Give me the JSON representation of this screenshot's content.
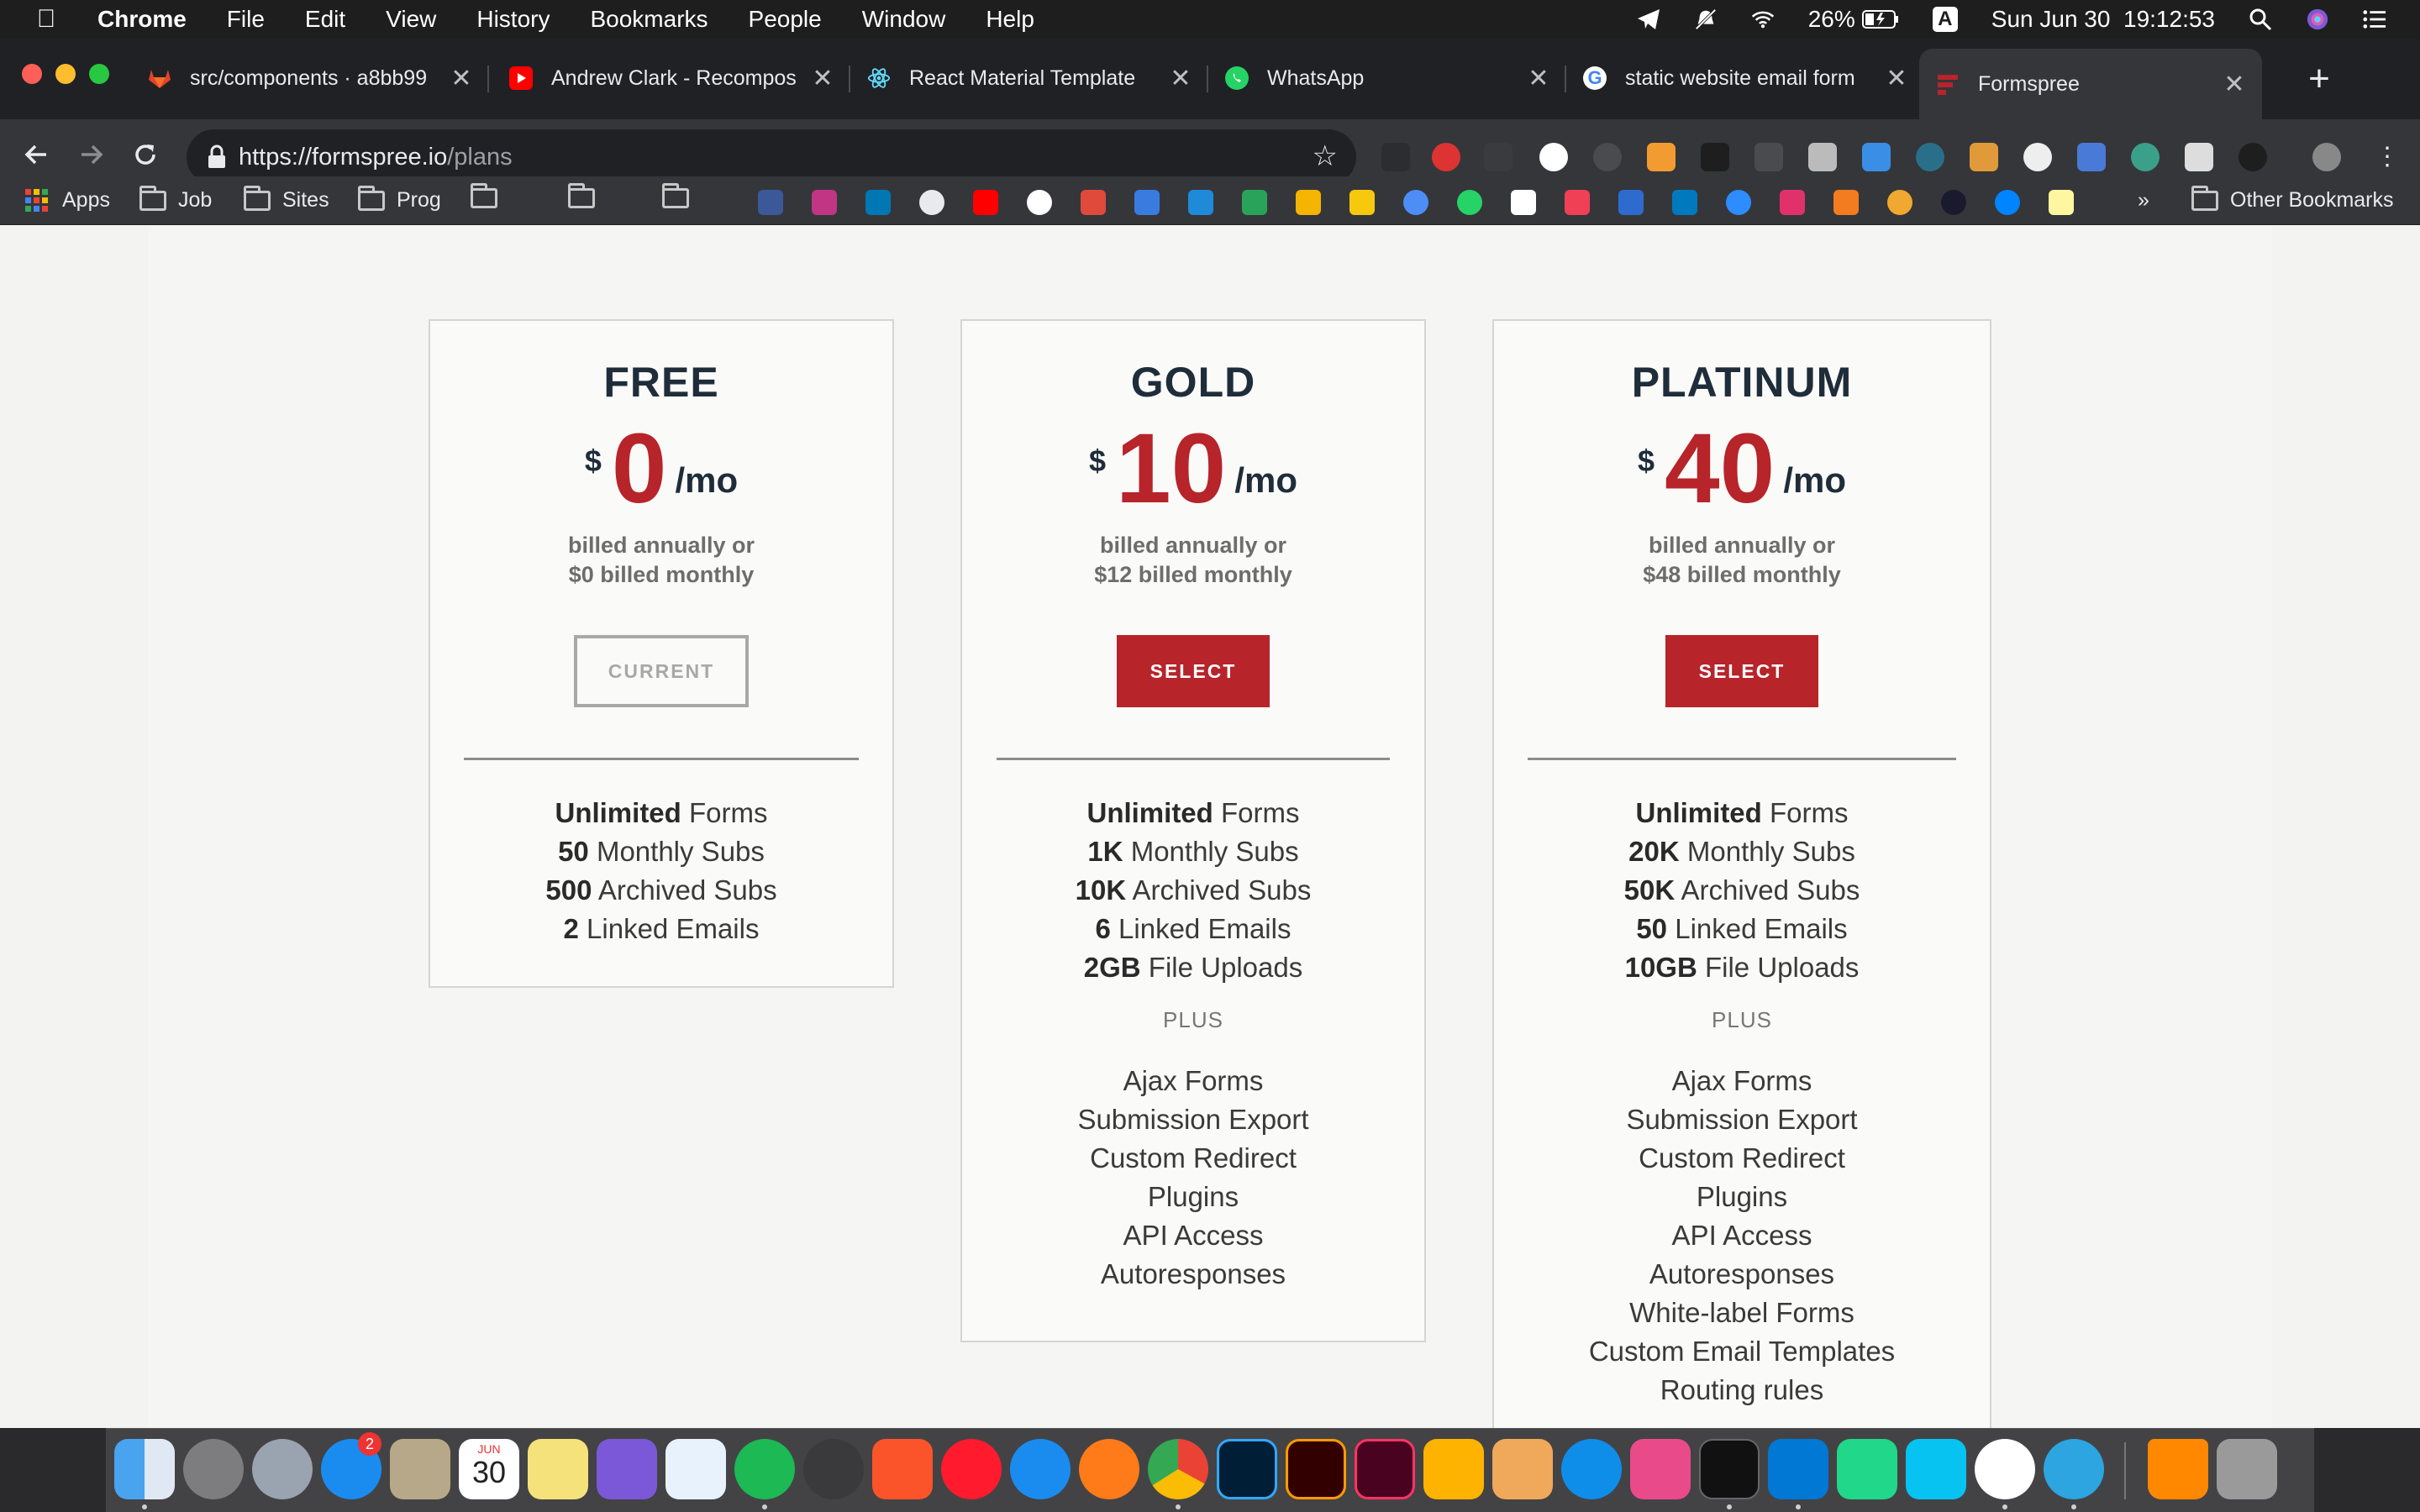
{
  "menubar": {
    "app_name": "Chrome",
    "menus": [
      "File",
      "Edit",
      "View",
      "History",
      "Bookmarks",
      "People",
      "Window",
      "Help"
    ],
    "battery": "26%",
    "input_source": "A",
    "datetime": "Sun Jun 30  19:12:53"
  },
  "tabs": [
    {
      "label": "src/components · a8bb99",
      "icon": "gitlab-icon",
      "color": "#e2432a"
    },
    {
      "label": "Andrew Clark - Recompos",
      "icon": "youtube-icon",
      "color": "#ff0000"
    },
    {
      "label": "React Material Template",
      "icon": "react-icon",
      "color": "#61dafb"
    },
    {
      "label": "WhatsApp",
      "icon": "whatsapp-icon",
      "color": "#25d366"
    },
    {
      "label": "static website email form",
      "icon": "google-icon",
      "color": "#4285f4"
    },
    {
      "label": "Formspree",
      "icon": "formspree-icon",
      "color": "#b7242a"
    }
  ],
  "address": {
    "scheme_host": "https://formspree.io",
    "path": "/plans"
  },
  "bookmarks": {
    "apps": "Apps",
    "folders": [
      "Job",
      "Sites",
      "Prog"
    ],
    "more": "»",
    "other": "Other Bookmarks"
  },
  "plans": [
    {
      "name": "FREE",
      "currency": "$",
      "amount": "0",
      "period": "/mo",
      "billing_line1": "billed annually or",
      "billing_line2": "$0 billed monthly",
      "button": "CURRENT",
      "features": [
        {
          "bold": "Unlimited",
          "text": " Forms"
        },
        {
          "bold": "50",
          "text": " Monthly Subs"
        },
        {
          "bold": "500",
          "text": " Archived Subs"
        },
        {
          "bold": "2",
          "text": " Linked Emails"
        }
      ],
      "plus": "",
      "extras": []
    },
    {
      "name": "GOLD",
      "currency": "$",
      "amount": "10",
      "period": "/mo",
      "billing_line1": "billed annually or",
      "billing_line2": "$12 billed monthly",
      "button": "SELECT",
      "features": [
        {
          "bold": "Unlimited",
          "text": " Forms"
        },
        {
          "bold": "1K",
          "text": " Monthly Subs"
        },
        {
          "bold": "10K",
          "text": " Archived Subs"
        },
        {
          "bold": "6",
          "text": " Linked Emails"
        },
        {
          "bold": "2GB",
          "text": " File Uploads"
        }
      ],
      "plus": "PLUS",
      "extras": [
        "Ajax Forms",
        "Submission Export",
        "Custom Redirect",
        "Plugins",
        "API Access",
        "Autoresponses"
      ]
    },
    {
      "name": "PLATINUM",
      "currency": "$",
      "amount": "40",
      "period": "/mo",
      "billing_line1": "billed annually or",
      "billing_line2": "$48 billed monthly",
      "button": "SELECT",
      "features": [
        {
          "bold": "Unlimited",
          "text": " Forms"
        },
        {
          "bold": "20K",
          "text": " Monthly Subs"
        },
        {
          "bold": "50K",
          "text": " Archived Subs"
        },
        {
          "bold": "50",
          "text": " Linked Emails"
        },
        {
          "bold": "10GB",
          "text": " File Uploads"
        }
      ],
      "plus": "PLUS",
      "extras": [
        "Ajax Forms",
        "Submission Export",
        "Custom Redirect",
        "Plugins",
        "API Access",
        "Autoresponses",
        "White-label Forms",
        "Custom Email Templates",
        "Routing rules"
      ]
    }
  ],
  "dock": {
    "calendar_day": "30",
    "calendar_month": "JUN",
    "appstore_badge": "2",
    "apps": [
      "finder-icon",
      "system-preferences-icon",
      "launchpad-icon",
      "app-store-icon",
      "calculator-icon",
      "calendar-icon",
      "stickies-icon",
      "discord-icon",
      "icloud-icon",
      "spotify-icon",
      "alfred-icon",
      "brave-icon",
      "opera-icon",
      "safari-icon",
      "firefox-icon",
      "chrome-icon",
      "photoshop-icon",
      "illustrator-icon",
      "indesign-icon",
      "sketch-icon",
      "transmit-icon",
      "teamviewer-icon",
      "cleanmymac-icon",
      "terminal-icon",
      "vscode-icon",
      "pycharm-icon",
      "webstorm-icon",
      "slack-icon",
      "telegram-icon",
      "vlc-icon",
      "trash-icon"
    ]
  },
  "colors": {
    "accent": "#b7242a",
    "heading": "#1f2d3a"
  }
}
